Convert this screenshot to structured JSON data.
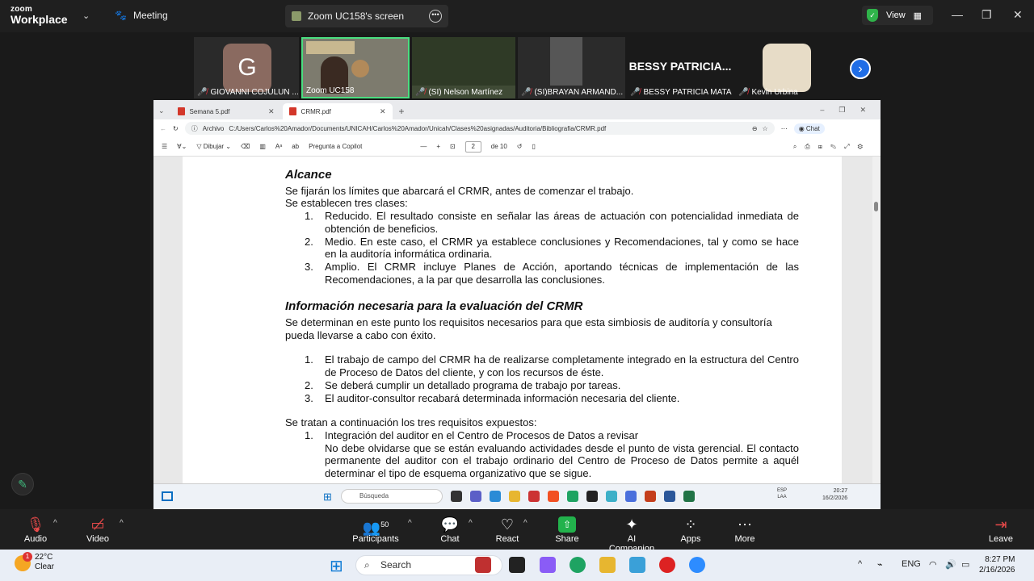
{
  "zoom": {
    "app_small": "zoom",
    "app_big": "Workplace",
    "meeting_label": "Meeting",
    "screen_label": "Zoom UC158's screen",
    "view_label": "View"
  },
  "participants": [
    {
      "name": "GIOVANNI COJULUN ...",
      "initial": "G"
    },
    {
      "name": "Zoom UC158"
    },
    {
      "name": "(SI) Nelson Martínez"
    },
    {
      "name": "(SI)BRAYAN ARMAND..."
    },
    {
      "name": "BESSY PATRICIA MATA ...",
      "big": "BESSY PATRICIA..."
    },
    {
      "name": "Kevin Urbina"
    }
  ],
  "browser": {
    "tabs": [
      {
        "label": "Semana 5.pdf"
      },
      {
        "label": "CRMR.pdf"
      }
    ],
    "archivo": "Archivo",
    "url": "C:/Users/Carlos%20Amador/Documents/UNICAH/Carlos%20Amador/Unicah/Clases%20asignadas/Auditoria/Bibliografia/CRMR.pdf",
    "chat": "Chat",
    "dibujar": "Dibujar",
    "copilot": "Pregunta a Copilot",
    "page_num": "2",
    "page_of": "de 10"
  },
  "doc": {
    "h1": "Alcance",
    "p1": "Se fijarán los límites que abarcará el CRMR, antes de comenzar el trabajo.",
    "p2": "Se establecen tres clases:",
    "list1": [
      {
        "n": "1.",
        "t": "Reducido. El resultado consiste en señalar las áreas de actuación con potencialidad inmediata de obtención de beneficios."
      },
      {
        "n": "2.",
        "t": "Medio. En este caso, el CRMR ya establece conclusiones y Recomendaciones, tal y como se hace en la auditoría informática ordinaria."
      },
      {
        "n": "3.",
        "t": "Amplio. El CRMR incluye Planes de Acción, aportando técnicas de implementación de las Recomendaciones, a la par que desarrolla las conclusiones."
      }
    ],
    "h2": "Información necesaria para la evaluación del CRMR",
    "p3": "Se determinan en este punto los requisitos necesarios para que esta simbiosis de auditoría y consultoría pueda llevarse a cabo con éxito.",
    "list2": [
      {
        "n": "1.",
        "t": "El trabajo de campo del CRMR ha de realizarse completamente integrado en la estructura del Centro de Proceso de Datos del cliente, y con los recursos de éste."
      },
      {
        "n": "2.",
        "t": "Se deberá cumplir un detallado programa de trabajo por tareas."
      },
      {
        "n": "3.",
        "t": "El auditor-consultor recabará determinada información necesaria del cliente."
      }
    ],
    "p4": "Se tratan a continuación los tres requisitos expuestos:",
    "list3_n": "1.",
    "list3_t": "Integración del auditor en el Centro de Procesos de Datos a revisar",
    "list3_body": "No debe olvidarse que se están evaluando actividades desde el punto de vista gerencial. El contacto permanente del auditor con el trabajo ordinario del Centro de Proceso de Datos permite a aquél determinar el tipo de esquema organizativo que se sigue."
  },
  "inner_taskbar": {
    "search": "Búsqueda",
    "lang1": "ESP",
    "lang2": "LAA",
    "time": "20:27",
    "date": "16/2/2026"
  },
  "controls": {
    "audio": "Audio",
    "video": "Video",
    "participants": "Participants",
    "participants_count": "50",
    "chat": "Chat",
    "react": "React",
    "share": "Share",
    "ai": "AI Companion",
    "apps": "Apps",
    "more": "More",
    "leave": "Leave"
  },
  "taskbar": {
    "temp": "22°C",
    "weather": "Clear",
    "badge": "1",
    "search": "Search",
    "lang": "ENG",
    "time": "8:27 PM",
    "date": "2/16/2026"
  }
}
